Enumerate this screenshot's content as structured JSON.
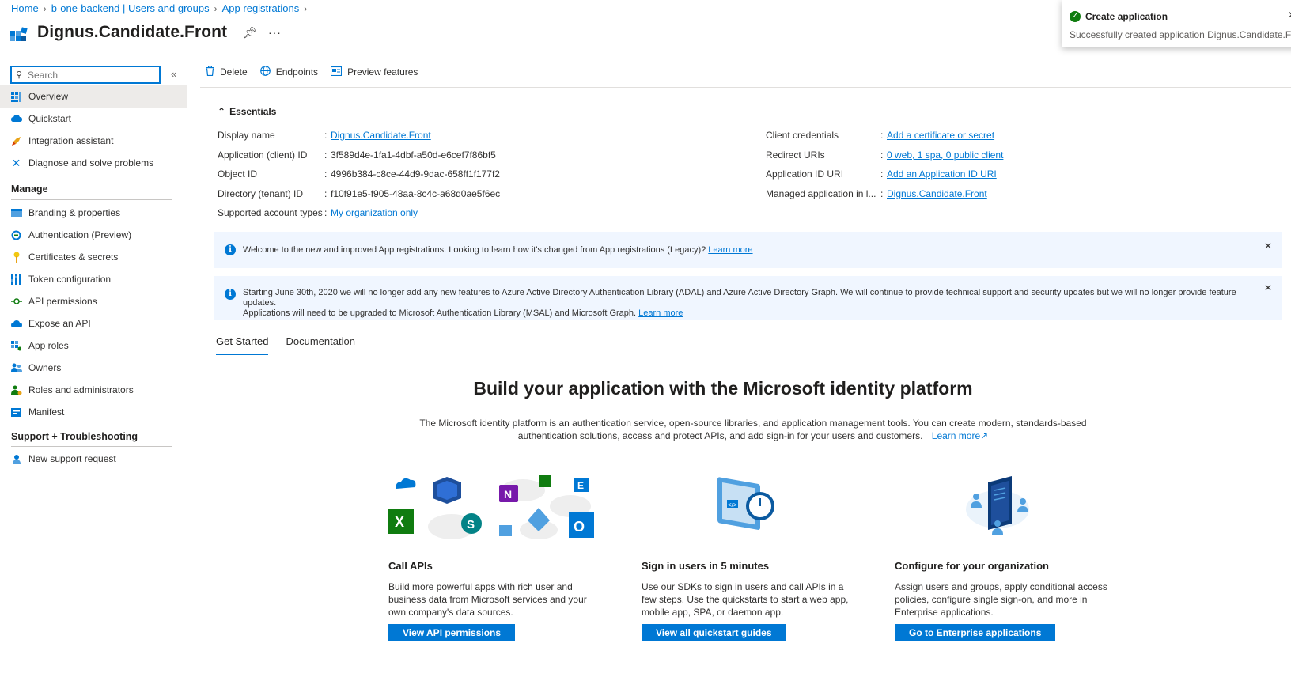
{
  "breadcrumb": [
    "Home",
    "b-one-backend | Users and groups",
    "App registrations"
  ],
  "title": "Dignus.Candidate.Front",
  "toast": {
    "title": "Create application",
    "message": "Successfully created application Dignus.Candidate.Front"
  },
  "sidebar": {
    "search_placeholder": "Search",
    "items_top": [
      {
        "label": "Overview",
        "icon": "overview-icon"
      },
      {
        "label": "Quickstart",
        "icon": "quickstart-icon"
      },
      {
        "label": "Integration assistant",
        "icon": "rocket-icon"
      },
      {
        "label": "Diagnose and solve problems",
        "icon": "wrench-icon"
      }
    ],
    "manage_label": "Manage",
    "manage_items": [
      {
        "label": "Branding & properties",
        "icon": "branding-icon"
      },
      {
        "label": "Authentication (Preview)",
        "icon": "authentication-icon"
      },
      {
        "label": "Certificates & secrets",
        "icon": "key-icon"
      },
      {
        "label": "Token configuration",
        "icon": "token-icon"
      },
      {
        "label": "API permissions",
        "icon": "api-permissions-icon"
      },
      {
        "label": "Expose an API",
        "icon": "cloud-icon"
      },
      {
        "label": "App roles",
        "icon": "app-roles-icon"
      },
      {
        "label": "Owners",
        "icon": "owners-icon"
      },
      {
        "label": "Roles and administrators",
        "icon": "roles-icon"
      },
      {
        "label": "Manifest",
        "icon": "manifest-icon"
      }
    ],
    "support_label": "Support + Troubleshooting",
    "support_items": [
      {
        "label": "New support request",
        "icon": "support-icon"
      }
    ]
  },
  "commands": {
    "delete": "Delete",
    "endpoints": "Endpoints",
    "preview": "Preview features"
  },
  "essentials": {
    "header": "Essentials",
    "left": [
      {
        "label": "Display name",
        "value": "Dignus.Candidate.Front",
        "link": true
      },
      {
        "label": "Application (client) ID",
        "value": "3f589d4e-1fa1-4dbf-a50d-e6cef7f86bf5",
        "link": false
      },
      {
        "label": "Object ID",
        "value": "4996b384-c8ce-44d9-9dac-658ff1f177f2",
        "link": false
      },
      {
        "label": "Directory (tenant) ID",
        "value": "f10f91e5-f905-48aa-8c4c-a68d0ae5f6ec",
        "link": false
      },
      {
        "label": "Supported account types",
        "value": "My organization only",
        "link": true
      }
    ],
    "right": [
      {
        "label": "Client credentials",
        "value": "Add a certificate or secret",
        "link": true
      },
      {
        "label": "Redirect URIs",
        "value": "0 web, 1 spa, 0 public client",
        "link": true
      },
      {
        "label": "Application ID URI",
        "value": "Add an Application ID URI",
        "link": true
      },
      {
        "label": "Managed application in l...",
        "value": "Dignus.Candidate.Front",
        "link": true
      }
    ]
  },
  "banners": [
    {
      "text": "Welcome to the new and improved App registrations. Looking to learn how it's changed from App registrations (Legacy)?",
      "link": "Learn more"
    },
    {
      "text": "Starting June 30th, 2020 we will no longer add any new features to Azure Active Directory Authentication Library (ADAL) and Azure Active Directory Graph. We will continue to provide technical support and security updates but we will no longer provide feature updates.",
      "text2": "Applications will need to be upgraded to Microsoft Authentication Library (MSAL) and Microsoft Graph.",
      "link": "Learn more"
    }
  ],
  "tabs": [
    "Get Started",
    "Documentation"
  ],
  "hero": {
    "title": "Build your application with the Microsoft identity platform",
    "desc": "The Microsoft identity platform is an authentication service, open-source libraries, and application management tools. You can create modern, standards-based authentication solutions, access and protect APIs, and add sign-in for your users and customers.",
    "link": "Learn more"
  },
  "cards": [
    {
      "title": "Call APIs",
      "desc": "Build more powerful apps with rich user and business data from Microsoft services and your own company's data sources.",
      "button": "View API permissions"
    },
    {
      "title": "Sign in users in 5 minutes",
      "desc": "Use our SDKs to sign in users and call APIs in a few steps. Use the quickstarts to start a web app, mobile app, SPA, or daemon app.",
      "button": "View all quickstart guides"
    },
    {
      "title": "Configure for your organization",
      "desc": "Assign users and groups, apply conditional access policies, configure single sign-on, and more in Enterprise applications.",
      "button": "Go to Enterprise applications"
    }
  ]
}
